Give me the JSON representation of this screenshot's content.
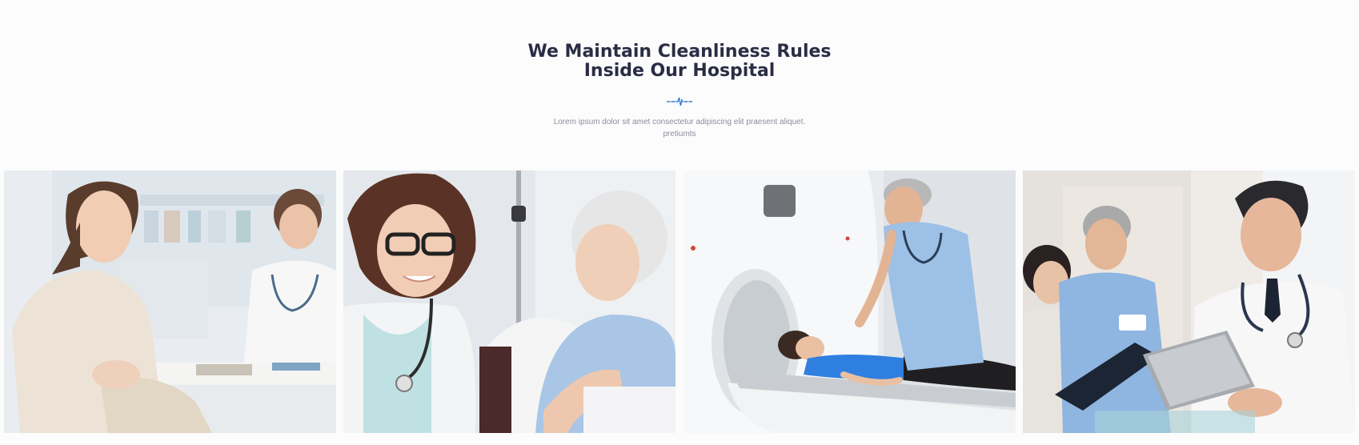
{
  "section": {
    "title_line1": "We Maintain Cleanliness Rules",
    "title_line2": "Inside Our Hospital",
    "description": "Lorem ipsum dolor sit amet consectetur adipiscing elit praesent aliquet. pretiumts"
  },
  "colors": {
    "title": "#2a2d44",
    "accent": "#3b7bd8",
    "text_muted": "#8a8f99"
  },
  "gallery": {
    "images": [
      {
        "name": "doctor-consultation-photo"
      },
      {
        "name": "doctor-with-elderly-patient-photo"
      },
      {
        "name": "ct-scan-patient-photo"
      },
      {
        "name": "medical-team-with-tablet-photo"
      }
    ]
  }
}
